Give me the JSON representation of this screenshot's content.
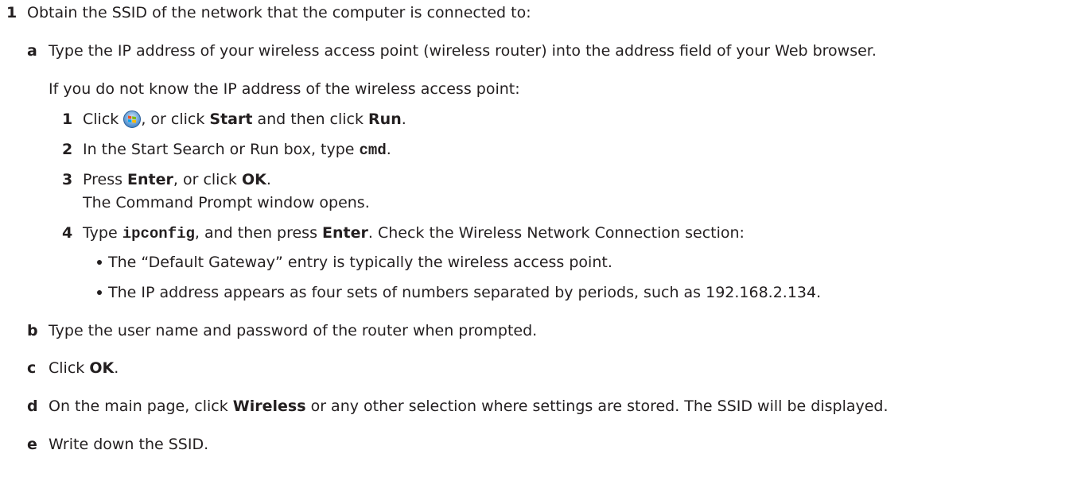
{
  "step1": {
    "number": "1",
    "text": "Obtain the SSID of the network that the computer is connected to:"
  },
  "step_a": {
    "letter": "a",
    "text": "Type the IP address of your wireless access point (wireless router) into the address field of your Web browser.",
    "note": "If you do not know the IP address of the wireless access point:",
    "substeps": {
      "s1": {
        "number": "1",
        "pre": "Click",
        "mid1": ", or click ",
        "start": "Start",
        "mid2": " and then click ",
        "run": "Run",
        "post": ".",
        "icon": "windows-start-orb-icon"
      },
      "s2": {
        "number": "2",
        "pre": "In the Start Search or Run box, type ",
        "cmd": "cmd",
        "post": "."
      },
      "s3": {
        "number": "3",
        "pre": "Press ",
        "enter": "Enter",
        "mid": ", or click ",
        "ok": "OK",
        "post": ".",
        "line2": "The Command Prompt window opens."
      },
      "s4": {
        "number": "4",
        "pre": "Type ",
        "cmd": "ipconfig",
        "mid": ", and then press ",
        "enter": "Enter",
        "post": ". Check the Wireless Network Connection section:",
        "bullets": [
          "The “Default Gateway” entry is typically the wireless access point.",
          "The IP address appears as four sets of numbers separated by periods, such as 192.168.2.134."
        ]
      }
    }
  },
  "step_b": {
    "letter": "b",
    "text": "Type the user name and password of the router when prompted."
  },
  "step_c": {
    "letter": "c",
    "pre": "Click ",
    "ok": "OK",
    "post": "."
  },
  "step_d": {
    "letter": "d",
    "pre": "On the main page, click ",
    "wireless": "Wireless",
    "post": " or any other selection where settings are stored. The SSID will be displayed."
  },
  "step_e": {
    "letter": "e",
    "text": "Write down the SSID."
  }
}
